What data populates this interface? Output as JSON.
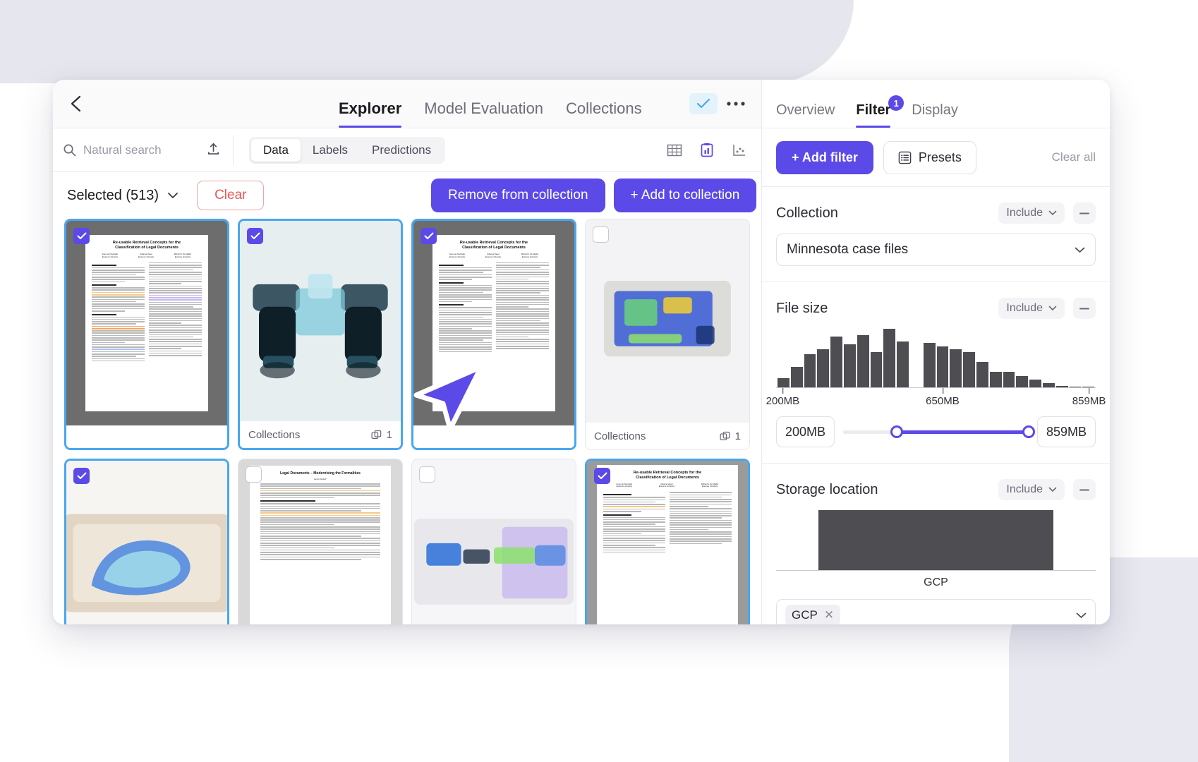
{
  "topbar": {
    "back_icon": "chevron-left-icon",
    "tabs": [
      {
        "label": "Explorer",
        "active": true
      },
      {
        "label": "Model Evaluation",
        "active": false
      },
      {
        "label": "Collections",
        "active": false
      }
    ],
    "check_icon": "check-icon",
    "more_icon": "ellipsis-icon"
  },
  "search": {
    "placeholder": "Natural search",
    "search_icon": "search-icon",
    "upload_icon": "upload-icon"
  },
  "segmented": {
    "items": [
      {
        "label": "Data",
        "active": true
      },
      {
        "label": "Labels",
        "active": false
      },
      {
        "label": "Predictions",
        "active": false
      }
    ]
  },
  "view_modes": [
    {
      "icon": "grid-view-icon",
      "active": false
    },
    {
      "icon": "chart-view-icon",
      "active": true
    },
    {
      "icon": "scatter-view-icon",
      "active": false
    }
  ],
  "selection": {
    "label": "Selected (513)",
    "caret_icon": "chevron-down-icon",
    "clear_label": "Clear",
    "remove_label": "Remove from collection",
    "add_label": "+ Add to collection"
  },
  "grid": {
    "cards": [
      {
        "kind": "doc",
        "selected": true,
        "footer": null
      },
      {
        "kind": "binoculars",
        "selected": true,
        "footer": {
          "label": "Collections",
          "count": "1",
          "icon": "collections-icon"
        }
      },
      {
        "kind": "doc",
        "selected": true,
        "footer": null
      },
      {
        "kind": "device",
        "selected": false,
        "footer": {
          "label": "Collections",
          "count": "1",
          "icon": "collections-icon"
        }
      },
      {
        "kind": "shoe",
        "selected": true,
        "footer": null
      },
      {
        "kind": "doc2",
        "selected": false,
        "footer": null
      },
      {
        "kind": "xray",
        "selected": false,
        "footer": null
      },
      {
        "kind": "doc",
        "selected": true,
        "footer": null
      }
    ],
    "cursor_icon": "cursor-arrow-icon"
  },
  "right_panel": {
    "tabs": [
      {
        "label": "Overview",
        "active": false,
        "badge": null
      },
      {
        "label": "Filter",
        "active": true,
        "badge": "1"
      },
      {
        "label": "Display",
        "active": false,
        "badge": null
      }
    ],
    "add_filter_label": "+ Add filter",
    "presets_label": "Presets",
    "presets_icon": "list-icon",
    "clear_all_label": "Clear all",
    "filters": [
      {
        "name": "collection",
        "title": "Collection",
        "mode": "Include",
        "minus_icon": "minus-icon",
        "value": "Minnesota case files",
        "chevron_icon": "chevron-down-icon"
      },
      {
        "name": "file-size",
        "title": "File size",
        "mode": "Include",
        "minus_icon": "minus-icon",
        "min_value": "200MB",
        "max_value": "859MB",
        "ticks": [
          "200MB",
          "650MB",
          "859MB"
        ]
      },
      {
        "name": "storage-location",
        "title": "Storage location",
        "mode": "Include",
        "minus_icon": "minus-icon",
        "category": "GCP",
        "chip": "GCP",
        "chip_remove_icon": "close-icon",
        "chevron_icon": "chevron-down-icon"
      }
    ]
  },
  "chart_data": [
    {
      "type": "bar",
      "name": "file-size-histogram",
      "title": "File size",
      "xlabel": "",
      "ylabel": "",
      "categories": [
        "200MB",
        "",
        "",
        "",
        "",
        "",
        "",
        "",
        "",
        "",
        "",
        "",
        "650MB",
        "",
        "",
        "",
        "",
        "",
        "",
        "",
        "",
        "",
        "",
        "859MB"
      ],
      "tick_labels": [
        "200MB",
        "650MB",
        "859MB"
      ],
      "tick_positions": [
        0.5,
        12.5,
        23.5
      ],
      "values": [
        12,
        26,
        42,
        48,
        64,
        54,
        66,
        45,
        74,
        58,
        0,
        56,
        52,
        48,
        45,
        32,
        20,
        20,
        14,
        10,
        5,
        2,
        1,
        1
      ],
      "selected_range": {
        "min": "200MB",
        "max": "859MB"
      },
      "grid": false
    },
    {
      "type": "bar",
      "name": "storage-location-chart",
      "title": "Storage location",
      "categories": [
        "GCP"
      ],
      "values": [
        100
      ],
      "ylim": [
        0,
        100
      ],
      "grid": false
    }
  ]
}
